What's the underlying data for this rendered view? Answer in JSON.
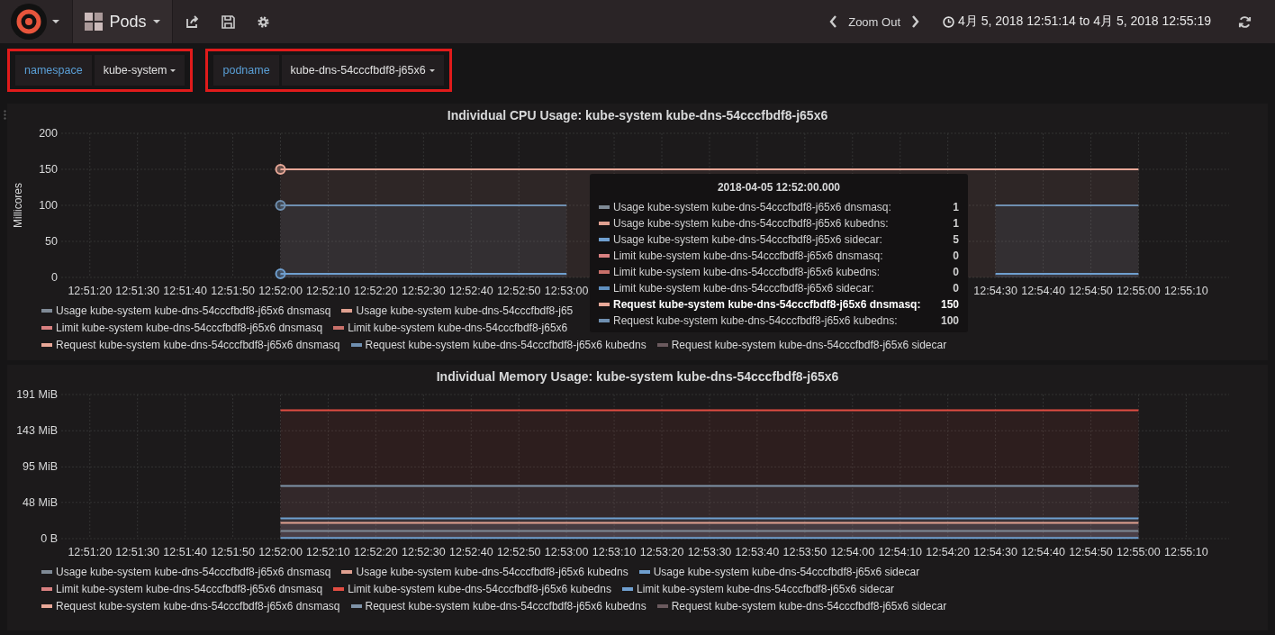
{
  "navbar": {
    "dashboard_title": "Pods",
    "zoom_label": "Zoom Out",
    "time_range": "4月 5, 2018 12:51:14 to 4月 5, 2018 12:55:19"
  },
  "variables": [
    {
      "label": "namespace",
      "value": "kube-system"
    },
    {
      "label": "podname",
      "value": "kube-dns-54cccfbdf8-j65x6"
    }
  ],
  "panels": [
    {
      "title": "Individual CPU Usage: kube-system kube-dns-54cccfbdf8-j65x6",
      "chart_data": {
        "type": "area",
        "grid": true,
        "ylabel": "Millicores",
        "ylim": [
          0,
          200
        ],
        "categories": [
          "12:51:20",
          "12:51:30",
          "12:51:40",
          "12:51:50",
          "12:52:00",
          "12:52:10",
          "12:52:20",
          "12:52:30",
          "12:52:40",
          "12:52:50",
          "12:53:00",
          null,
          null,
          null,
          null,
          null,
          null,
          null,
          null,
          "12:54:30",
          "12:54:40",
          "12:54:50",
          "12:55:00",
          "12:55:10"
        ],
        "yticks": [
          0,
          50,
          100,
          150,
          200
        ],
        "series": [
          {
            "color": "#6f9fcf",
            "values": [
              null,
              null,
              null,
              null,
              5,
              5,
              5,
              5,
              5,
              5,
              5,
              null,
              null,
              null,
              null,
              null,
              null,
              null,
              null,
              5,
              5,
              5,
              5,
              null
            ]
          },
          {
            "color": "#e8a898",
            "values": [
              null,
              null,
              null,
              null,
              150,
              150,
              150,
              150,
              150,
              150,
              150,
              150,
              150,
              150,
              150,
              150,
              150,
              150,
              150,
              150,
              150,
              150,
              150,
              null
            ]
          },
          {
            "color": "#6f8fb0",
            "values": [
              null,
              null,
              null,
              null,
              100,
              100,
              100,
              100,
              100,
              100,
              100,
              null,
              null,
              null,
              null,
              null,
              null,
              null,
              null,
              100,
              100,
              100,
              100,
              null
            ]
          }
        ]
      },
      "legend_rows": [
        {
          "items": [
            {
              "label": "Usage kube-system kube-dns-54cccfbdf8-j65x6 dnsmasq",
              "color": "#7f8a96"
            },
            {
              "label": "Usage kube-system kube-dns-54cccfbdf8-j65",
              "color": "#e0a090"
            }
          ]
        },
        {
          "items": [
            {
              "label": "Limit kube-system kube-dns-54cccfbdf8-j65x6 dnsmasq",
              "color": "#d98080"
            },
            {
              "label": "Limit kube-system kube-dns-54cccfbdf8-j65x6",
              "color": "#c8706a"
            }
          ]
        },
        {
          "items": [
            {
              "label": "Request kube-system kube-dns-54cccfbdf8-j65x6 dnsmasq",
              "color": "#e8a898"
            },
            {
              "label": "Request kube-system kube-dns-54cccfbdf8-j65x6 kubedns",
              "color": "#6f8fb0"
            },
            {
              "label": "Request kube-system kube-dns-54cccfbdf8-j65x6 sidecar",
              "color": "#6b5a5e"
            }
          ]
        }
      ],
      "tooltip": {
        "title": "2018-04-05 12:52:00.000",
        "rows": [
          {
            "label": "Usage kube-system kube-dns-54cccfbdf8-j65x6 dnsmasq:",
            "value": "1",
            "color": "#7f8a96",
            "highlighted": false
          },
          {
            "label": "Usage kube-system kube-dns-54cccfbdf8-j65x6 kubedns:",
            "value": "1",
            "color": "#e0a090",
            "highlighted": false
          },
          {
            "label": "Usage kube-system kube-dns-54cccfbdf8-j65x6 sidecar:",
            "value": "5",
            "color": "#6f9fcf",
            "highlighted": false
          },
          {
            "label": "Limit kube-system kube-dns-54cccfbdf8-j65x6 dnsmasq:",
            "value": "0",
            "color": "#d98080",
            "highlighted": false
          },
          {
            "label": "Limit kube-system kube-dns-54cccfbdf8-j65x6 kubedns:",
            "value": "0",
            "color": "#c8706a",
            "highlighted": false
          },
          {
            "label": "Limit kube-system kube-dns-54cccfbdf8-j65x6 sidecar:",
            "value": "0",
            "color": "#5f8fbf",
            "highlighted": false
          },
          {
            "label": "Request kube-system kube-dns-54cccfbdf8-j65x6 dnsmasq:",
            "value": "150",
            "color": "#e8a898",
            "highlighted": true
          },
          {
            "label": "Request kube-system kube-dns-54cccfbdf8-j65x6 kubedns:",
            "value": "100",
            "color": "#6f8fb0",
            "highlighted": false
          }
        ]
      }
    },
    {
      "title": "Individual Memory Usage: kube-system kube-dns-54cccfbdf8-j65x6",
      "chart_data": {
        "type": "area",
        "grid": true,
        "ylim": [
          0,
          191
        ],
        "categories": [
          "12:51:20",
          "12:51:30",
          "12:51:40",
          "12:51:50",
          "12:52:00",
          "12:52:10",
          "12:52:20",
          "12:52:30",
          "12:52:40",
          "12:52:50",
          "12:53:00",
          "12:53:10",
          "12:53:20",
          "12:53:30",
          "12:53:40",
          "12:53:50",
          "12:54:00",
          "12:54:10",
          "12:54:20",
          "12:54:30",
          "12:54:40",
          "12:54:50",
          "12:55:00",
          "12:55:10"
        ],
        "yticks": [
          {
            "value": 0,
            "label": "0 B"
          },
          {
            "value": 48,
            "label": "48 MiB"
          },
          {
            "value": 95,
            "label": "95 MiB"
          },
          {
            "value": 143,
            "label": "143 MiB"
          },
          {
            "value": 191,
            "label": "191 MiB"
          }
        ],
        "series": [
          {
            "color": "#7f8a96",
            "values": [
              null,
              null,
              null,
              null,
              10,
              10,
              10,
              10,
              10,
              10,
              10,
              10,
              10,
              10,
              10,
              10,
              10,
              10,
              10,
              10,
              10,
              10,
              10,
              null
            ]
          },
          {
            "color": "#e0a090",
            "values": [
              null,
              null,
              null,
              null,
              21,
              21,
              21,
              21,
              21,
              21,
              21,
              21,
              21,
              21,
              21,
              21,
              21,
              21,
              21,
              21,
              21,
              21,
              21,
              null
            ]
          },
          {
            "color": "#6f9fcf",
            "values": [
              null,
              null,
              null,
              null,
              1,
              1,
              1,
              1,
              1,
              1,
              1,
              1,
              1,
              1,
              1,
              1,
              1,
              1,
              1,
              1,
              1,
              1,
              1,
              null
            ]
          },
          {
            "color": "#e24d42",
            "values": [
              null,
              null,
              null,
              null,
              170,
              170,
              170,
              170,
              170,
              170,
              170,
              170,
              170,
              170,
              170,
              170,
              170,
              170,
              170,
              170,
              170,
              170,
              170,
              null
            ]
          },
          {
            "color": "#6f9fcf",
            "values": [
              null,
              null,
              null,
              null,
              27,
              27,
              27,
              27,
              27,
              27,
              27,
              27,
              27,
              27,
              27,
              27,
              27,
              27,
              27,
              27,
              27,
              27,
              27,
              null
            ]
          },
          {
            "color": "#7f93a8",
            "values": [
              null,
              null,
              null,
              null,
              70,
              70,
              70,
              70,
              70,
              70,
              70,
              70,
              70,
              70,
              70,
              70,
              70,
              70,
              70,
              70,
              70,
              70,
              70,
              null
            ]
          }
        ]
      },
      "legend_rows": [
        {
          "items": [
            {
              "label": "Usage kube-system kube-dns-54cccfbdf8-j65x6 dnsmasq",
              "color": "#7f8a96"
            },
            {
              "label": "Usage kube-system kube-dns-54cccfbdf8-j65x6 kubedns",
              "color": "#e0a090"
            },
            {
              "label": "Usage kube-system kube-dns-54cccfbdf8-j65x6 sidecar",
              "color": "#6f9fcf"
            }
          ]
        },
        {
          "items": [
            {
              "label": "Limit kube-system kube-dns-54cccfbdf8-j65x6 dnsmasq",
              "color": "#d98080"
            },
            {
              "label": "Limit kube-system kube-dns-54cccfbdf8-j65x6 kubedns",
              "color": "#e24d42"
            },
            {
              "label": "Limit kube-system kube-dns-54cccfbdf8-j65x6 sidecar",
              "color": "#6f9fcf"
            }
          ]
        },
        {
          "items": [
            {
              "label": "Request kube-system kube-dns-54cccfbdf8-j65x6 dnsmasq",
              "color": "#e8a898"
            },
            {
              "label": "Request kube-system kube-dns-54cccfbdf8-j65x6 kubedns",
              "color": "#7f93a8"
            },
            {
              "label": "Request kube-system kube-dns-54cccfbdf8-j65x6 sidecar",
              "color": "#6b5a5e"
            }
          ]
        }
      ]
    }
  ]
}
